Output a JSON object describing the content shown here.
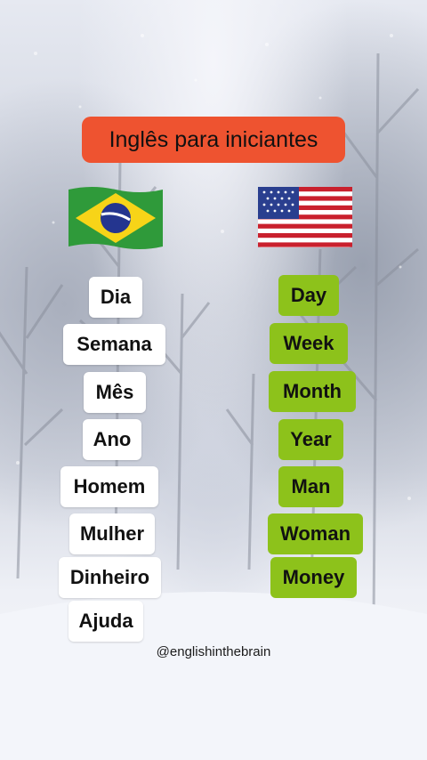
{
  "title": "Inglês para iniciantes",
  "flags": {
    "left": "brazil-flag",
    "right": "usa-flag"
  },
  "colors": {
    "title_bg": "#ee5330",
    "english_bg": "#8dc21b",
    "portuguese_bg": "#ffffff"
  },
  "portuguese": [
    "Dia",
    "Semana",
    "Mês",
    "Ano",
    "Homem",
    "Mulher",
    "Dinheiro",
    "Ajuda"
  ],
  "english": [
    "Day",
    "Week",
    "Month",
    "Year",
    "Man",
    "Woman",
    "Money"
  ],
  "handle": "@englishinthebrain"
}
